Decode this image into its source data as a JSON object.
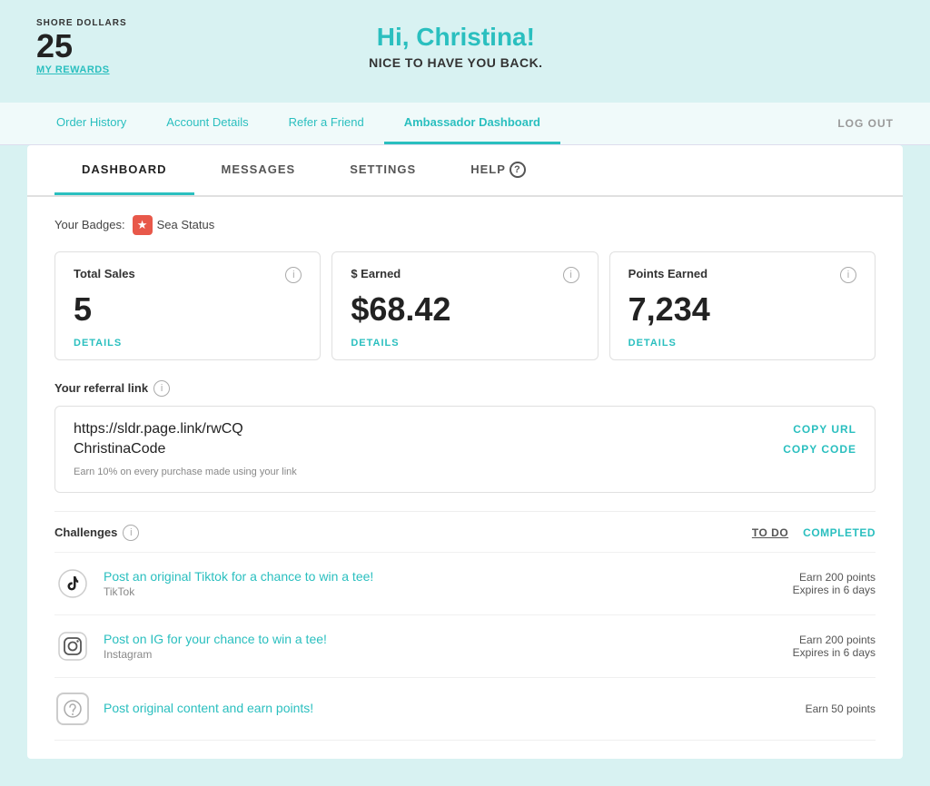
{
  "header": {
    "shore_dollars_label": "SHORE DOLLARS",
    "shore_dollars_amount": "25",
    "my_rewards_label": "MY REWARDS",
    "welcome_title": "Hi, Christina!",
    "welcome_sub": "NICE TO HAVE YOU BACK."
  },
  "nav": {
    "tabs": [
      {
        "label": "Order History",
        "active": false
      },
      {
        "label": "Account Details",
        "active": false
      },
      {
        "label": "Refer a Friend",
        "active": false
      },
      {
        "label": "Ambassador Dashboard",
        "active": true
      }
    ],
    "logout_label": "LOG OUT"
  },
  "inner_nav": {
    "tabs": [
      {
        "label": "DASHBOARD",
        "active": true
      },
      {
        "label": "MESSAGES",
        "active": false
      },
      {
        "label": "SETTINGS",
        "active": false
      },
      {
        "label": "HELP",
        "active": false
      }
    ]
  },
  "badges": {
    "label": "Your Badges:",
    "items": [
      {
        "name": "Sea Status"
      }
    ]
  },
  "stats": [
    {
      "title": "Total Sales",
      "value": "5",
      "details_label": "DETAILS"
    },
    {
      "title": "$ Earned",
      "value": "$68.42",
      "details_label": "DETAILS"
    },
    {
      "title": "Points Earned",
      "value": "7,234",
      "details_label": "DETAILS"
    }
  ],
  "referral": {
    "title": "Your referral link",
    "url": "https://sldr.page.link/rwCQ",
    "code": "ChristinaCode",
    "copy_url_label": "COPY URL",
    "copy_code_label": "COPY CODE",
    "earn_note": "Earn 10% on every purchase made using your link"
  },
  "challenges": {
    "title": "Challenges",
    "todo_label": "TO DO",
    "completed_label": "COMPLETED",
    "items": [
      {
        "platform": "TikTok",
        "name": "Post an original Tiktok for a chance to win a tee!",
        "points": "Earn 200 points",
        "expires": "Expires in 6 days"
      },
      {
        "platform": "Instagram",
        "name": "Post on IG for your chance to win a tee!",
        "points": "Earn 200 points",
        "expires": "Expires in 6 days"
      },
      {
        "platform": "",
        "name": "Post original content and earn points!",
        "points": "Earn 50 points",
        "expires": ""
      }
    ]
  }
}
